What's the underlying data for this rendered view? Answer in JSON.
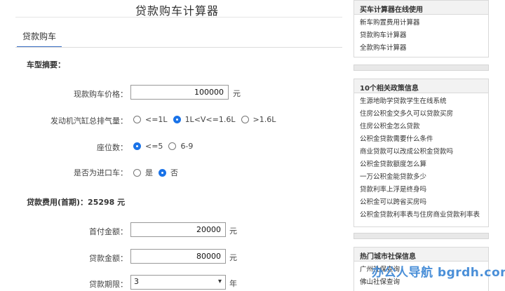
{
  "page": {
    "title": "贷款购车计算器"
  },
  "tabs": [
    {
      "label": "贷款购车"
    }
  ],
  "form": {
    "model_summary_title": "车型摘要：",
    "car_price": {
      "label": "现款购车价格：",
      "value": "100000",
      "unit": "元"
    },
    "displacement": {
      "label": "发动机汽缸总排气量：",
      "options": [
        "<=1L",
        "1L<V<=1.6L",
        ">1.6L"
      ],
      "selected": "1L<V<=1.6L"
    },
    "seats": {
      "label": "座位数：",
      "options": [
        "<=5",
        "6-9"
      ],
      "selected": "<=5"
    },
    "imported": {
      "label": "是否为进口车：",
      "options": [
        "是",
        "否"
      ],
      "selected": "否"
    },
    "loan_cost_title": "贷款费用(首期)：25298 元",
    "down_payment": {
      "label": "首付金额：",
      "value": "20000",
      "unit": "元"
    },
    "loan_amount": {
      "label": "贷款金额：",
      "value": "80000",
      "unit": "元"
    },
    "loan_term": {
      "label": "贷款期限：",
      "value": "3",
      "unit": "年"
    }
  },
  "sidebar": {
    "box1": {
      "title": "买车计算器在线使用",
      "items": [
        "新车购置费用计算器",
        "贷款购车计算器",
        "全款购车计算器"
      ]
    },
    "box2": {
      "title": "10个相关政策信息",
      "items": [
        "生源地助学贷款学生在线系统",
        "住房公积金交多久可以贷款买房",
        "住房公积金怎么贷款",
        "公积金贷款需要什么条件",
        "商业贷款可以改成公积金贷款吗",
        "公积金贷款额度怎么算",
        "一万公积金能贷款多少",
        "贷款利率上浮是终身吗",
        "公积金可以跨省买房吗",
        "公积金贷款利率表与住房商业贷款利率表"
      ]
    },
    "box3": {
      "title": "热门城市社保信息",
      "items": [
        "广州社保查询",
        "佛山社保查询"
      ]
    }
  },
  "watermark": "办公人导航 bgrdh.com",
  "colors": {
    "accent": "#1a73e8",
    "tab_underline": "#3a6fc4",
    "watermark": "#4a8fd8"
  }
}
